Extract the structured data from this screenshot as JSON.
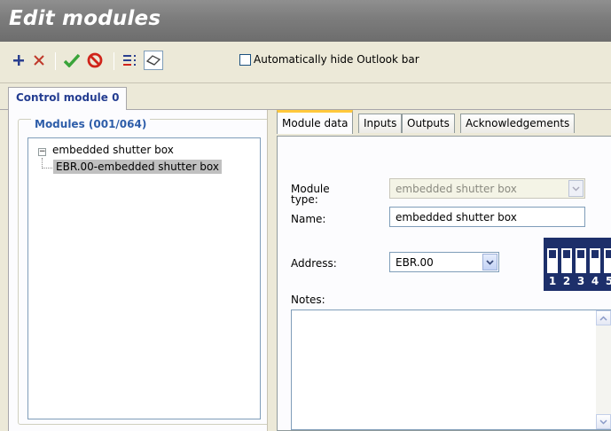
{
  "window": {
    "title": "Edit modules"
  },
  "toolbar": {
    "buttons": [
      {
        "icon": "plus-icon",
        "color": "#2a3f8f"
      },
      {
        "icon": "delete-x-icon",
        "color": "#c0392b"
      },
      {
        "icon": "checkmark-icon",
        "color": "#3aa43a"
      },
      {
        "icon": "cancel-icon",
        "color": "#d0241a"
      },
      {
        "icon": "reorder-icon",
        "color": "#2a3f8f"
      },
      {
        "icon": "eraser-icon",
        "color": "#555555"
      }
    ],
    "auto_hide_label": "Automatically hide Outlook bar",
    "auto_hide_checked": false
  },
  "tabs": {
    "control_module": "Control module 0"
  },
  "modules_panel": {
    "title": "Modules (001/064)",
    "tree_root": "embedded shutter box",
    "tree_child": "EBR.00-embedded shutter box",
    "expander": "−"
  },
  "detail_tabs": [
    "Module data",
    "Inputs",
    "Outputs",
    "Acknowledgements"
  ],
  "module_data": {
    "module_type_label": "Module\ntype:",
    "module_type_value": "embedded shutter box",
    "name_label": "Name:",
    "name_value": "embedded shutter box",
    "address_label": "Address:",
    "address_value": "EBR.00",
    "notes_label": "Notes:",
    "notes_value": "",
    "dip_switch_numbers": [
      "1",
      "2",
      "3",
      "4",
      "5"
    ]
  },
  "colors": {
    "title_text": "#ffffff",
    "active_tab_accent": "#ffc83c",
    "panel_title": "#2d5da9",
    "dip_background": "#1d2f6a"
  }
}
